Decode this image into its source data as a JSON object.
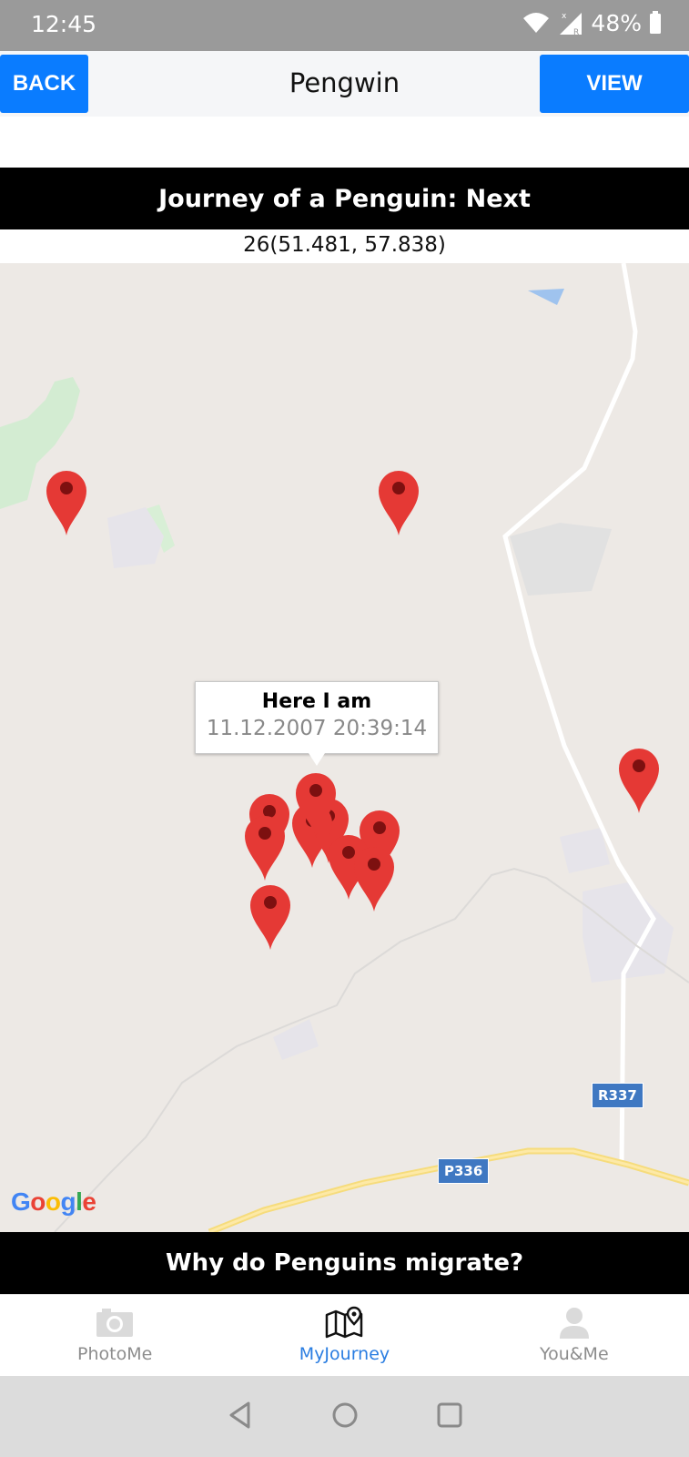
{
  "status": {
    "time": "12:45",
    "battery": "48%"
  },
  "header": {
    "back_label": "BACK",
    "title": "Pengwin",
    "view_label": "VIEW"
  },
  "journey": {
    "banner": "Journey of a Penguin: Next",
    "coords": "26(51.481, 57.838)"
  },
  "map": {
    "info_window": {
      "title": "Here I am",
      "timestamp": "11.12.2007 20:39:14"
    },
    "road_labels": {
      "r337": "R337",
      "p336": "P336"
    },
    "logo": {
      "g": "G",
      "o1": "o",
      "o2": "o",
      "g2": "g",
      "l": "l",
      "e": "e"
    },
    "pin_color": "#e53935"
  },
  "migrate_banner": "Why do Penguins migrate?",
  "tabs": [
    {
      "label": "PhotoMe",
      "icon": "camera-icon"
    },
    {
      "label": "MyJourney",
      "icon": "map-icon",
      "active": true
    },
    {
      "label": "You&Me",
      "icon": "person-icon"
    }
  ],
  "colors": {
    "accent": "#0a7cff",
    "active_tab": "#2a7de1"
  }
}
